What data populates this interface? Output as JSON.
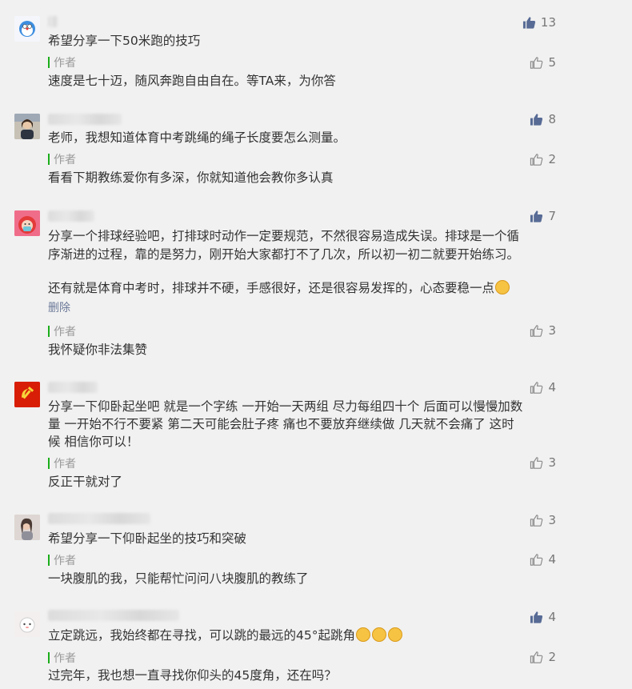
{
  "comments": [
    {
      "text": "希望分享一下50米跑的技巧",
      "likes": "13",
      "reply_tag": "作者",
      "reply_text": "速度是七十迈，随风奔跑自由自在。等TA来，为你答",
      "reply_likes": "5"
    },
    {
      "text": "老师，我想知道体育中考跳绳的绳子长度要怎么测量。",
      "likes": "8",
      "reply_tag": "作者",
      "reply_text": "看看下期教练爱你有多深，你就知道他会教你多认真",
      "reply_likes": "2"
    },
    {
      "text_line1": "分享一个排球经验吧，打排球时动作一定要规范，不然很容易造成失误。排球是一个循",
      "text_line2": "序渐进的过程，靠的是努力，刚开始大家都打不了几次，所以初一初二就要开始练习。",
      "text_line3": "还有就是体育中考时，排球并不硬，手感很好，还是很容易发挥的，心态要稳一点",
      "likes": "7",
      "delete_label": "删除",
      "reply_tag": "作者",
      "reply_text": "我怀疑你非法集赞",
      "reply_likes": "3"
    },
    {
      "text_line1": "分享一下仰卧起坐吧 就是一个字练 一开始一天两组 尽力每组四十个 后面可以慢慢加数",
      "text_line2": "量 一开始不行不要紧 第二天可能会肚子疼 痛也不要放弃继续做 几天就不会痛了 这时",
      "text_line3": "候 相信你可以！",
      "likes": "4",
      "reply_tag": "作者",
      "reply_text": "反正干就对了",
      "reply_likes": "3"
    },
    {
      "text": "希望分享一下仰卧起坐的技巧和突破",
      "likes": "3",
      "reply_tag": "作者",
      "reply_text": "一块腹肌的我，只能帮忙问问八块腹肌的教练了",
      "reply_likes": "4"
    },
    {
      "text": "立定跳远，我始终都在寻找，可以跳的最远的45°起跳角",
      "likes": "4",
      "reply_tag": "作者",
      "reply_text": "过完年，我也想一直寻找你仰头的45度角，还在吗？",
      "reply_likes": "2"
    }
  ],
  "icons": {
    "like_filled": "thumb-up-filled-icon",
    "like_outline": "thumb-up-outline-icon",
    "emoji": "thinking-face-emoji-icon"
  },
  "colors": {
    "background": "#f1f1f1",
    "author_bar": "#1aad19",
    "thumb_filled": "#576b95",
    "muted_text": "#999999",
    "link_text": "#6b7a99"
  }
}
